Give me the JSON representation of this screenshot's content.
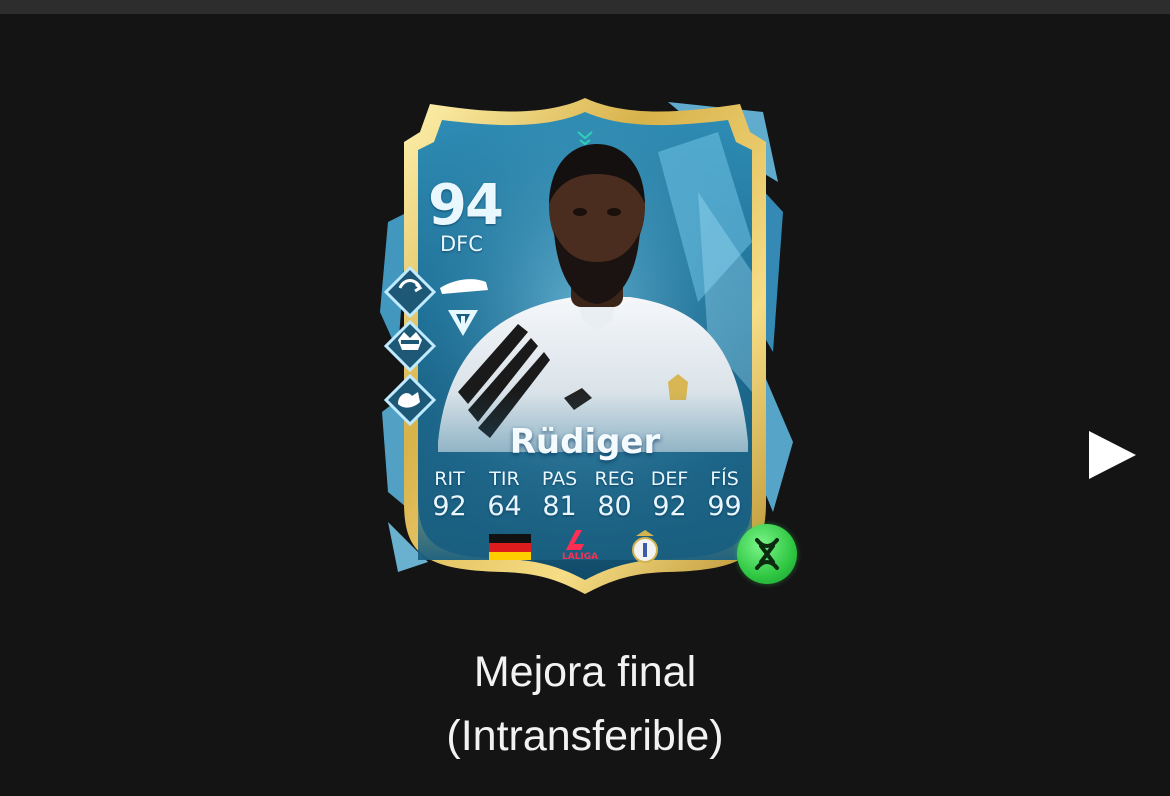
{
  "card": {
    "rating": "94",
    "position": "DFC",
    "name": "Rüdiger",
    "stats": [
      {
        "label": "RIT",
        "value": "92"
      },
      {
        "label": "TIR",
        "value": "64"
      },
      {
        "label": "PAS",
        "value": "81"
      },
      {
        "label": "REG",
        "value": "80"
      },
      {
        "label": "DEF",
        "value": "92"
      },
      {
        "label": "FÍS",
        "value": "99"
      }
    ],
    "league_logo_text": "LALIGA",
    "icons": {
      "playstyles": [
        "anticipate-icon",
        "raccoon-playstyle-icon",
        "bruiser-arm-icon"
      ],
      "boot": "boot-icon",
      "role": "role-plus-icon",
      "nation": "germany-flag-icon",
      "club": "real-madrid-crest-icon",
      "evolution": "evolution-badge-icon"
    },
    "colors": {
      "frame_gold": "#e3c25a",
      "card_teal": "#1f6f94",
      "evolution_green": "#3fd150"
    }
  },
  "caption": {
    "line1": "Mejora final",
    "line2": "(Intransferible)"
  },
  "nav": {
    "next_icon": "play-arrow-icon"
  }
}
